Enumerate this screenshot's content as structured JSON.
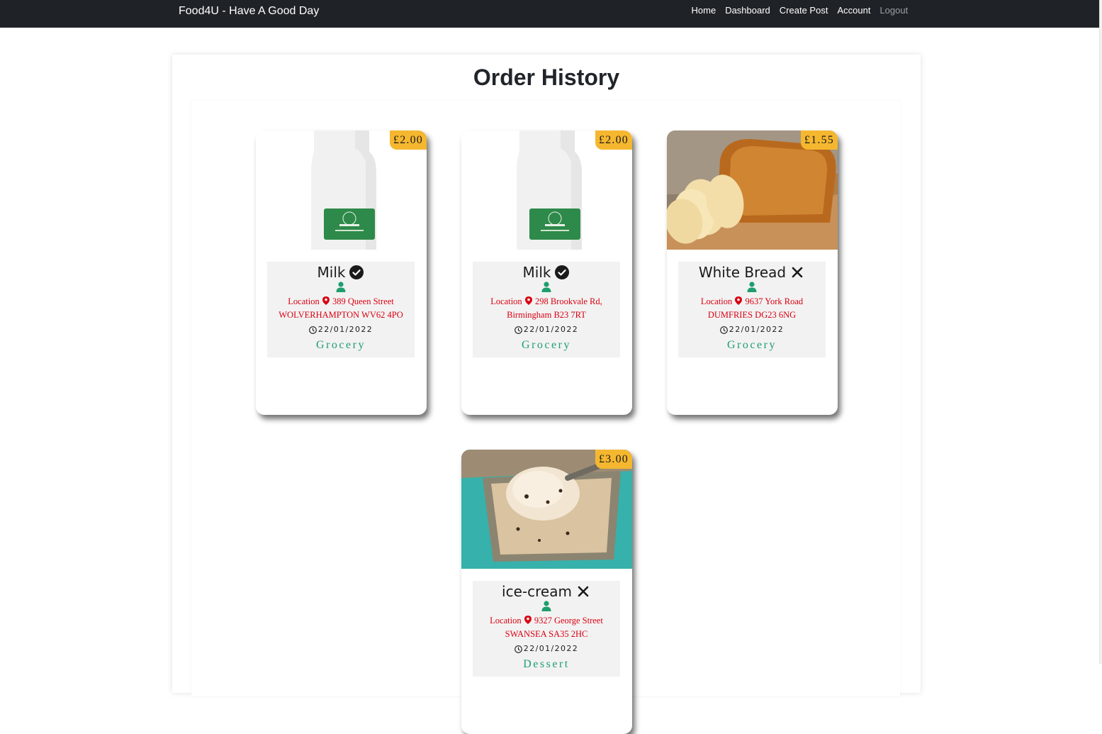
{
  "nav": {
    "brand": "Food4U - Have A Good Day",
    "links": [
      "Home",
      "Dashboard",
      "Create Post",
      "Account"
    ],
    "logout": "Logout"
  },
  "page": {
    "title": "Order History"
  },
  "colors": {
    "navbar": "#1f2327",
    "price_badge": "#f5b72f",
    "location_text": "#d90011",
    "category_text": "#1e9e6e",
    "user_icon": "#1e9e6e"
  },
  "orders": [
    {
      "price": "£2.00",
      "title": "Milk",
      "status_icon": "check-circle-icon",
      "location_label": "Location",
      "address": "389 Queen Street WOLVERHAMPTON WV62 4PO",
      "date": "22/01/2022",
      "category": "Grocery",
      "image": "milk-bottle"
    },
    {
      "price": "£2.00",
      "title": "Milk",
      "status_icon": "check-circle-icon",
      "location_label": "Location",
      "address": "298 Brookvale Rd, Birmingham B23 7RT",
      "date": "22/01/2022",
      "category": "Grocery",
      "image": "milk-bottle"
    },
    {
      "price": "£1.55",
      "title": "White Bread",
      "status_icon": "x-mark-icon",
      "location_label": "Location",
      "address": "9637 York Road DUMFRIES DG23 6NG",
      "date": "22/01/2022",
      "category": "Grocery",
      "image": "sliced-bread-loaf"
    },
    {
      "price": "£3.00",
      "title": "ice-cream",
      "status_icon": "x-mark-icon",
      "location_label": "Location",
      "address": "9327 George Street SWANSEA SA35 2HC",
      "date": "22/01/2022",
      "category": "Dessert",
      "image": "ice-cream-scoop"
    }
  ]
}
